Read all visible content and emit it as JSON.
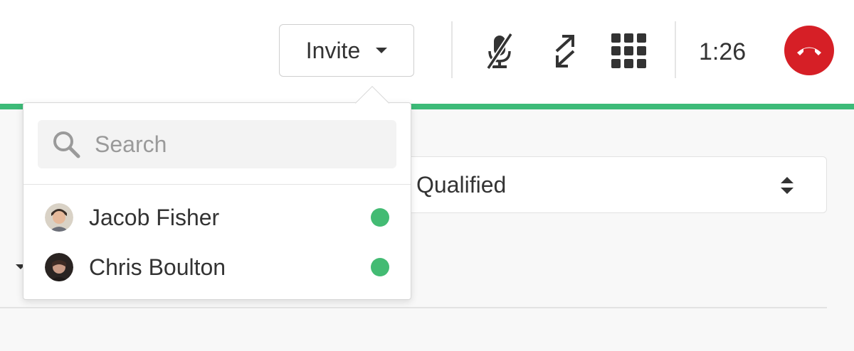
{
  "colors": {
    "accent_green": "#3dbb78",
    "hangup_red": "#d61f26",
    "online_green": "#43bb73"
  },
  "toolbar": {
    "invite_label": "Invite",
    "mute_icon": "microphone-off-icon",
    "transfer_icon": "transfer-arrows-icon",
    "keypad_icon": "keypad-grid-icon",
    "timer": "1:26",
    "hangup_icon": "phone-hangup-icon"
  },
  "background": {
    "status_select_value": "Qualified"
  },
  "invite_popover": {
    "search_placeholder": "Search",
    "search_value": "",
    "users": [
      {
        "name": "Jacob Fisher",
        "status": "online"
      },
      {
        "name": "Chris Boulton",
        "status": "online"
      }
    ]
  }
}
